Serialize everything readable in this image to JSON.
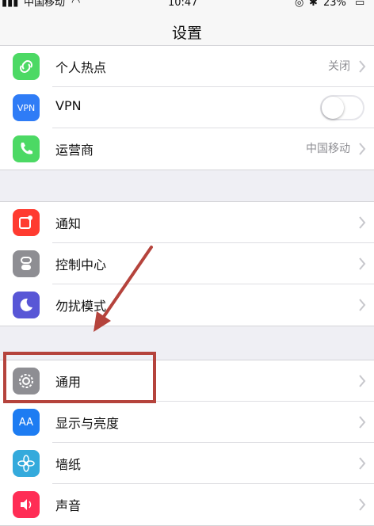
{
  "status_bar": {
    "carrier": "中国移动",
    "time": "10:47",
    "battery": "23%"
  },
  "nav": {
    "title": "设置"
  },
  "groups": [
    {
      "rows": [
        {
          "label": "个人热点",
          "value": "关闭",
          "icon": "hotspot-icon",
          "color": "#4cd964",
          "control": "chevron"
        },
        {
          "label": "VPN",
          "value": "",
          "icon_text": "VPN",
          "icon": "vpn-icon",
          "color": "#2f7cf6",
          "control": "toggle",
          "toggle_on": false
        },
        {
          "label": "运营商",
          "value": "中国移动",
          "icon": "phone-icon",
          "color": "#4cd964",
          "control": "chevron"
        }
      ]
    },
    {
      "rows": [
        {
          "label": "通知",
          "icon": "notifications-icon",
          "color": "#ff3b30",
          "control": "chevron"
        },
        {
          "label": "控制中心",
          "icon": "control-center-icon",
          "color": "#8e8e93",
          "control": "chevron"
        },
        {
          "label": "勿扰模式",
          "icon": "moon-icon",
          "color": "#5856d6",
          "control": "chevron"
        }
      ]
    },
    {
      "rows": [
        {
          "label": "通用",
          "icon": "gear-icon",
          "color": "#8e8e93",
          "control": "chevron"
        },
        {
          "label": "显示与亮度",
          "icon_text": "AA",
          "icon": "display-brightness-icon",
          "color": "#1d7cf2",
          "control": "chevron"
        },
        {
          "label": "墙纸",
          "icon": "flower-icon",
          "color": "#34aadc",
          "control": "chevron"
        },
        {
          "label": "声音",
          "icon": "speaker-icon",
          "color": "#ff2d55",
          "control": "chevron"
        }
      ]
    }
  ],
  "annotation": {
    "highlight_color": "#b5433c"
  }
}
